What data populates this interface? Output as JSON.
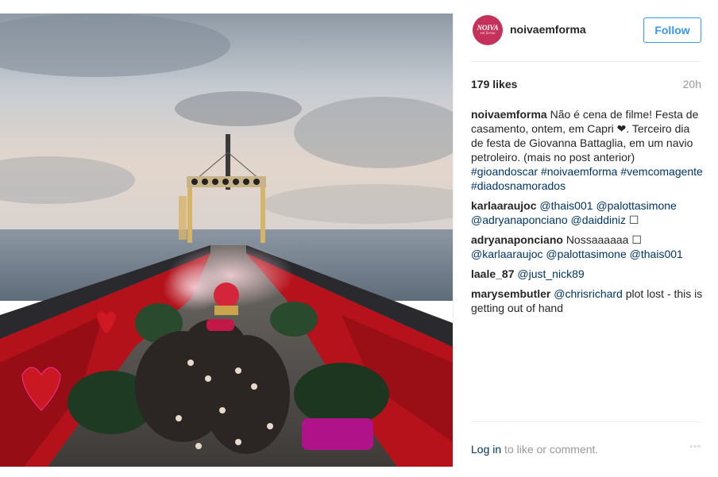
{
  "post": {
    "photo": {
      "description_icon": "photo",
      "alt": ""
    },
    "header": {
      "avatar": {
        "brand": "NOIVA",
        "brand_sub": "em forma"
      },
      "username": "noivaemforma",
      "follow_label": "Follow"
    },
    "stats": {
      "likes": "179 likes",
      "time": "20h"
    },
    "caption": {
      "user": "noivaemforma",
      "text": "Não é cena de filme! Festa de casamento, ontem, em Capri ❤. Terceiro dia de festa de Giovanna Battaglia, em um navio petroleiro. (mais no post anterior)",
      "tags": [
        "#gioandoscar",
        "#noivaemforma",
        "#vemcomagente",
        "#diadosnamorados"
      ]
    },
    "comments": [
      {
        "user": "karlaaraujoc",
        "tags": [
          "@thais001",
          "@palottasimone",
          "@adryanaponciano",
          "@daiddiniz"
        ],
        "text": "☐"
      },
      {
        "user": "adryanaponciano",
        "text_before": "Nossaaaaaa ☐",
        "tags": [
          "@karlaaraujoc",
          "@palottasimone",
          "@thais001"
        ]
      },
      {
        "user": "laale_87",
        "tags": [
          "@just_nick89"
        ]
      },
      {
        "user": "marysembutler",
        "tags": [
          "@chrisrichard"
        ],
        "text": "plot lost - this is getting out of hand"
      }
    ],
    "footer": {
      "login_label": "Log in",
      "login_suffix": " to like or comment.",
      "more_label": "◦◦◦"
    }
  }
}
